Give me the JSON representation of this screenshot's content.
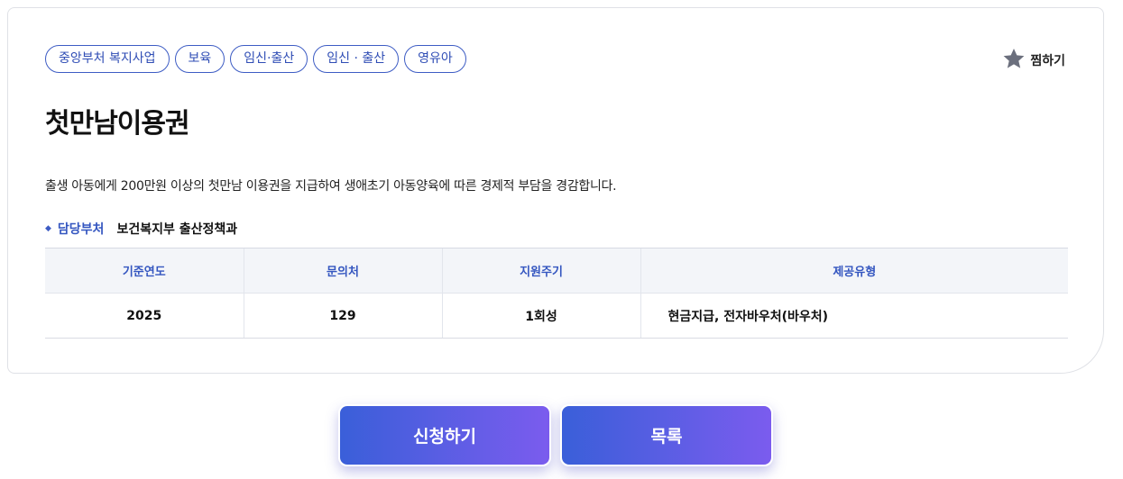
{
  "tags": [
    "중앙부처 복지사업",
    "보육",
    "임신·출산",
    "임신 · 출산",
    "영유아"
  ],
  "favorite": {
    "label": "찜하기",
    "icon": "star-icon"
  },
  "service": {
    "title": "첫만남이용권",
    "description": "출생 아동에게 200만원 이상의 첫만남 이용권을 지급하여 생애초기 아동양육에 따른 경제적 부담을 경감합니다."
  },
  "department": {
    "label": "담당부처",
    "value": "보건복지부 출산정책과"
  },
  "table": {
    "headers": [
      "기준연도",
      "문의처",
      "지원주기",
      "제공유형"
    ],
    "row": [
      "2025",
      "129",
      "1회성",
      "현금지급, 전자바우처(바우처)"
    ]
  },
  "actions": {
    "apply_label": "신청하기",
    "list_label": "목록"
  },
  "colors": {
    "accent": "#3456c0",
    "button_start": "#3a5fd9",
    "button_end": "#7b5cee",
    "star": "#6b6f7d"
  }
}
